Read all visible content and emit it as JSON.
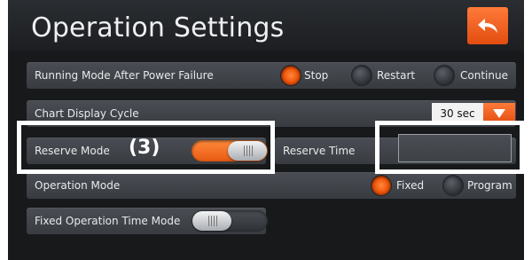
{
  "page": {
    "title": "Operation Settings",
    "back_icon": "back-arrow-icon"
  },
  "colors": {
    "accent": "#f05a10",
    "row_bg": "#43474d",
    "screen_bg": "#17191b",
    "highlight": "#ffffff"
  },
  "running_mode": {
    "label": "Running Mode After Power Failure",
    "options": [
      {
        "label": "Stop",
        "selected": true
      },
      {
        "label": "Restart",
        "selected": false
      },
      {
        "label": "Continue",
        "selected": false
      }
    ]
  },
  "chart_cycle": {
    "label": "Chart Display Cycle",
    "value": "30 sec",
    "dropdown_icon": "triangle-down-icon"
  },
  "reserve_mode": {
    "label": "Reserve Mode",
    "annotation": "(3)",
    "toggle_on": true
  },
  "reserve_time": {
    "label": "Reserve Time",
    "value": ""
  },
  "operation_mode": {
    "label": "Operation Mode",
    "options": [
      {
        "label": "Fixed",
        "selected": true
      },
      {
        "label": "Program",
        "selected": false
      }
    ]
  },
  "fixed_time_mode": {
    "label": "Fixed Operation Time Mode",
    "toggle_on": false
  }
}
